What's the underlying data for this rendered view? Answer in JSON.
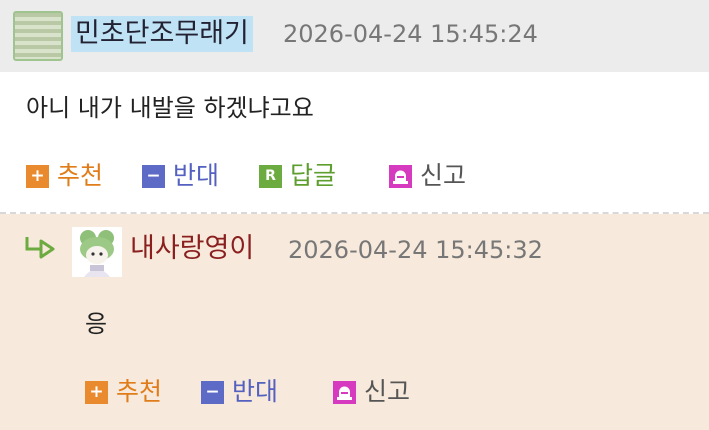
{
  "comments": [
    {
      "nickname": "민초단조무래기",
      "datetime": "2026-04-24 15:45:24",
      "text": "아니 내가 내발을 하겠냐고요",
      "actions": {
        "recommend": "추천",
        "oppose": "반대",
        "reply": "답글",
        "report": "신고"
      }
    },
    {
      "nickname": "내사랑영이",
      "datetime": "2026-04-24 15:45:32",
      "text": "응",
      "actions": {
        "recommend": "추천",
        "oppose": "반대",
        "report": "신고"
      }
    }
  ],
  "icons": {
    "recommend": "plus-icon",
    "oppose": "minus-icon",
    "reply": "reply-r-icon",
    "report": "siren-icon",
    "reply_indicator": "reply-arrow-icon"
  },
  "colors": {
    "recommend": "#e88a2d",
    "oppose": "#5d6ac6",
    "reply": "#6cab3f",
    "report": "#d63bbf",
    "nickname_highlight": "#bfe3f5",
    "reply_background": "#f7e9db"
  }
}
